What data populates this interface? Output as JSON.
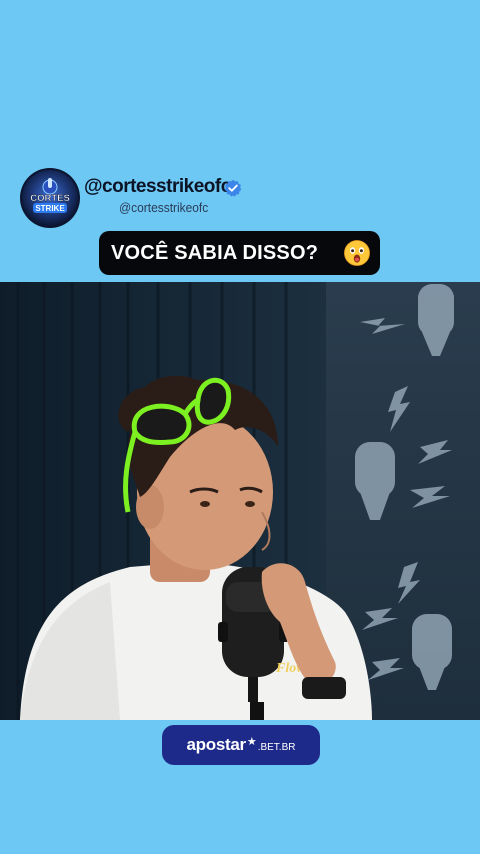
{
  "profile": {
    "avatar_text_top": "CORTES",
    "avatar_text_bottom": "STRIKE",
    "handle": "@cortesstrikeofc",
    "subhandle": "@cortesstrikeofc",
    "verified_icon": "verified-check-icon"
  },
  "headline": {
    "text": "VOCÊ SABIA DISSO?",
    "emoji": "astonished-face-emoji"
  },
  "video": {
    "description_icons": [
      "microphone-icon",
      "lightning-icon"
    ],
    "mic_brand": "Flow"
  },
  "sponsor": {
    "brand": "apostar",
    "suffix": ".BET.BR"
  },
  "colors": {
    "background": "#6dc8f4",
    "headline_bg": "#07080b",
    "sponsor_bg": "#1e2a8a",
    "sunglasses": "#7cf020"
  }
}
